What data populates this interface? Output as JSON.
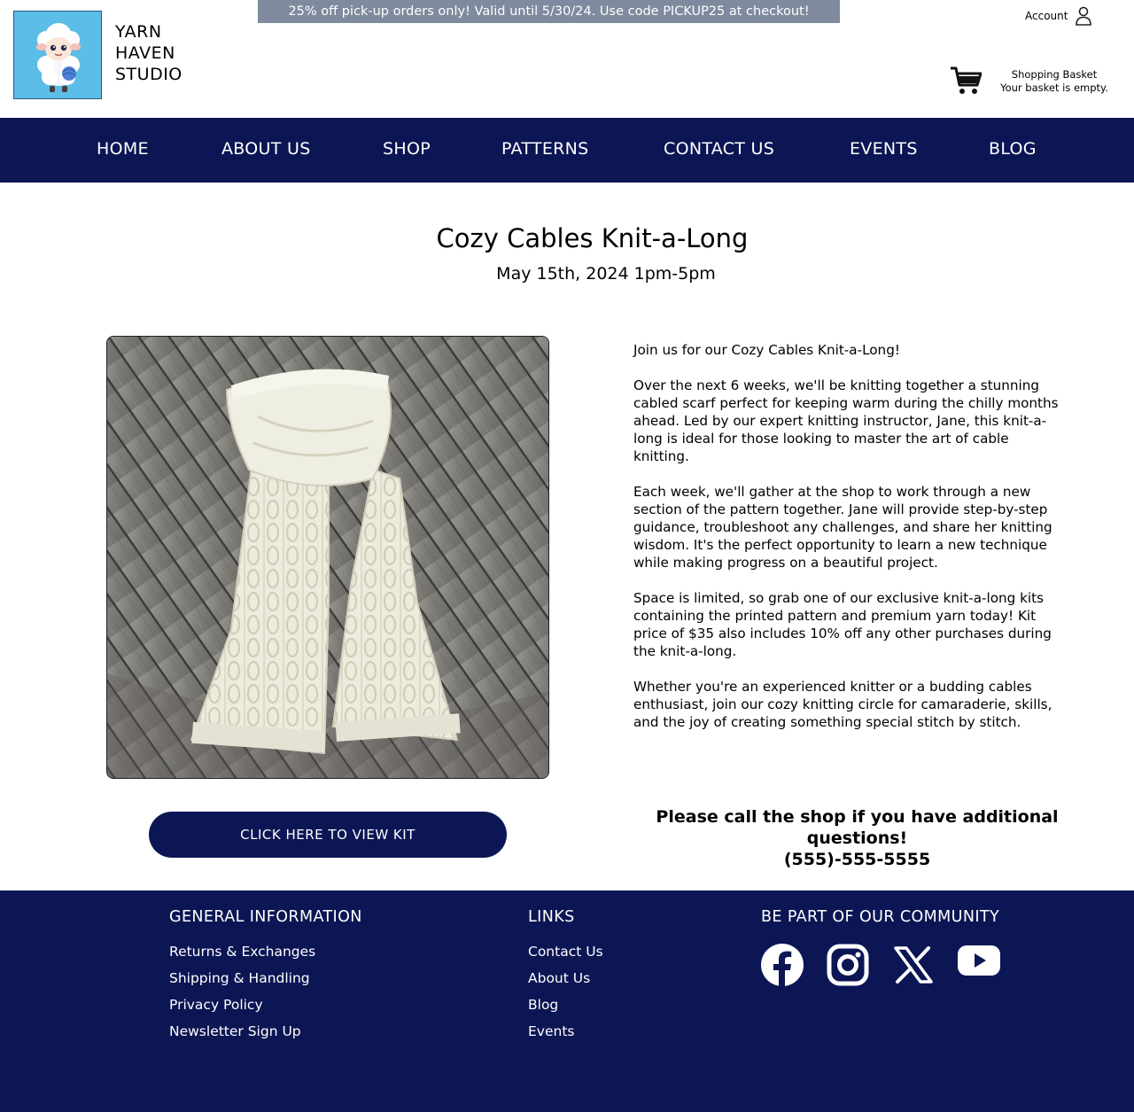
{
  "header": {
    "brand_lines": [
      "YARN",
      "HAVEN",
      "STUDIO"
    ],
    "promo": "25% off pick-up orders only! Valid until 5/30/24. Use code PICKUP25 at checkout!",
    "account_label": "Account",
    "basket_title": "Shopping Basket",
    "basket_status": "Your basket is empty."
  },
  "nav": {
    "items": [
      "HOME",
      "ABOUT US",
      "SHOP",
      "PATTERNS",
      "CONTACT US",
      "EVENTS",
      "BLOG"
    ]
  },
  "event": {
    "title": "Cozy Cables Knit-a-Long",
    "date": "May 15th, 2024 1pm-5pm",
    "paragraphs": [
      "Join us for our Cozy Cables Knit-a-Long!",
      "Over the next 6 weeks, we'll be knitting together a stunning cabled scarf perfect for keeping warm during the chilly months ahead. Led by our expert knitting instructor, Jane, this knit-a-long is ideal for those looking to master the art of cable knitting.",
      "Each week, we'll gather at the shop to work through a new section of the pattern together. Jane will provide step-by-step guidance, troubleshoot any challenges, and share her knitting wisdom. It's the perfect opportunity to learn a new technique while making progress on a beautiful project.",
      "Space is limited, so grab one of our exclusive knit-a-long kits containing the printed pattern and premium yarn today! Kit price of $35 also includes 10% off any other purchases during the knit-a-long.",
      "Whether you're an experienced knitter or a budding cables enthusiast, join our cozy knitting circle for camaraderie, skills, and the joy of creating something special stitch by stitch."
    ],
    "kit_button": "CLICK HERE TO VIEW KIT",
    "callout_line1": "Please call the shop if you have additional questions!",
    "callout_phone": "(555)-555-5555"
  },
  "footer": {
    "general_heading": "GENERAL INFORMATION",
    "general_links": [
      "Returns & Exchanges",
      "Shipping & Handling",
      "Privacy Policy",
      "Newsletter Sign Up"
    ],
    "links_heading": "LINKS",
    "links": [
      "Contact Us",
      "About Us",
      "Blog",
      "Events"
    ],
    "community_heading": "BE PART OF OUR COMMUNITY",
    "social_icons": [
      "facebook-icon",
      "instagram-icon",
      "x-icon",
      "youtube-icon"
    ]
  },
  "colors": {
    "navy": "#0c1654",
    "promo_bg": "#7f8a9e",
    "logo_bg": "#5cbde6"
  }
}
